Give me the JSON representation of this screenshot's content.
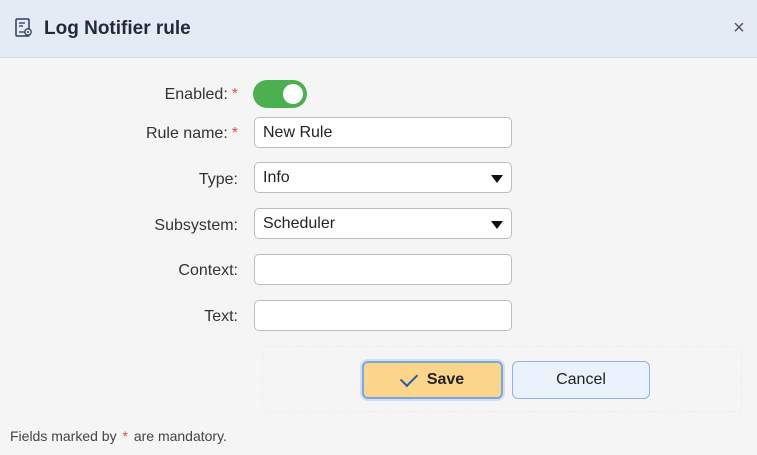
{
  "dialog": {
    "title": "Log Notifier rule",
    "close_glyph": "×",
    "title_icon": "document-settings-icon"
  },
  "form": {
    "required_marker": "*",
    "enabled": {
      "label": "Enabled:",
      "value": true
    },
    "rule_name": {
      "label": "Rule name:",
      "value": "New Rule"
    },
    "type": {
      "label": "Type:",
      "value": "Info"
    },
    "subsystem": {
      "label": "Subsystem:",
      "value": "Scheduler"
    },
    "context": {
      "label": "Context:",
      "value": ""
    },
    "text": {
      "label": "Text:",
      "value": ""
    }
  },
  "buttons": {
    "save_label": "Save",
    "cancel_label": "Cancel"
  },
  "footer": {
    "note_before": "Fields marked by",
    "note_marker": "*",
    "note_after": "are mandatory."
  },
  "colors": {
    "toggle_on": "#4caf50",
    "required": "#d9534f",
    "save_button": "#fbd58a",
    "title_bar": "#e4ebf5"
  }
}
